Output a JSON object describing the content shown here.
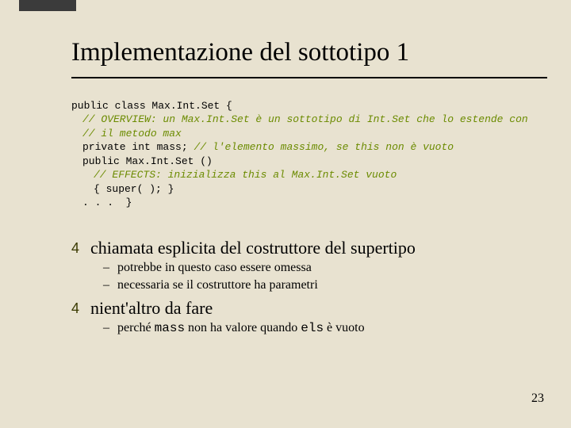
{
  "title": "Implementazione del sottotipo 1",
  "code": {
    "l1": "public class Max.Int.Set {",
    "l2": "// OVERVIEW: un Max.Int.Set è un sottotipo di Int.Set che lo estende con",
    "l3": "// il metodo max",
    "l4a": "private int mass; ",
    "l4b": "// l'elemento massimo, se this non è vuoto",
    "l5": "public Max.Int.Set ()",
    "l6": "// EFFECTS: inizializza this al Max.Int.Set vuoto",
    "l7": "{ super( ); }",
    "l8": ". . .  }"
  },
  "bullets": {
    "b1": "chiamata esplicita del costruttore del supertipo",
    "b1_1": "potrebbe in questo caso essere omessa",
    "b1_2": "necessaria se il costruttore ha parametri",
    "b2": "nient'altro da fare",
    "b2_1a": "perché ",
    "b2_1b": "mass",
    "b2_1c": " non ha valore quando ",
    "b2_1d": "els",
    "b2_1e": " è vuoto"
  },
  "tick": "4",
  "pagenum": "23"
}
